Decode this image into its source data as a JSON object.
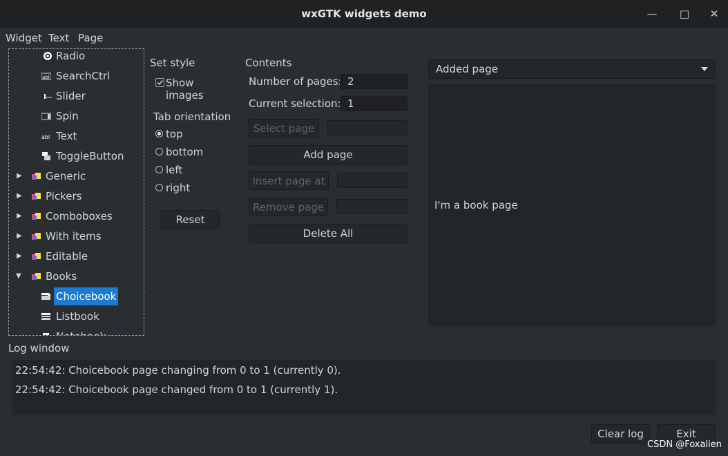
{
  "window": {
    "title": "wxGTK widgets demo",
    "minimize": "—",
    "maximize": "□",
    "close": "✕"
  },
  "menu": [
    "Widget",
    "Text",
    "Page"
  ],
  "tree": {
    "items": [
      {
        "label": "Radio",
        "icon": "radio-icon"
      },
      {
        "label": "SearchCtrl",
        "icon": "searchctrl-icon"
      },
      {
        "label": "Slider",
        "icon": "slider-icon"
      },
      {
        "label": "Spin",
        "icon": "spin-icon"
      },
      {
        "label": "Text",
        "icon": "text-icon"
      },
      {
        "label": "ToggleButton",
        "icon": "togglebutton-icon"
      },
      {
        "label": "Generic",
        "icon": "category-icon"
      },
      {
        "label": "Pickers",
        "icon": "category-icon"
      },
      {
        "label": "Comboboxes",
        "icon": "category-icon"
      },
      {
        "label": "With items",
        "icon": "category-icon"
      },
      {
        "label": "Editable",
        "icon": "category-icon"
      },
      {
        "label": "Books",
        "icon": "category-icon"
      },
      {
        "label": "Choicebook",
        "icon": "book-icon"
      },
      {
        "label": "Listbook",
        "icon": "book-icon"
      },
      {
        "label": "Notebook",
        "icon": "book-icon"
      }
    ]
  },
  "style": {
    "heading": "Set style",
    "show_images": "Show images",
    "tab_orientation": "Tab orientation",
    "options": [
      "top",
      "bottom",
      "left",
      "right"
    ],
    "reset": "Reset"
  },
  "contents": {
    "heading": "Contents",
    "num_pages_label": "Number of pages:",
    "num_pages_value": "2",
    "current_sel_label": "Current selection:",
    "current_sel_value": "1",
    "select_page": "Select page",
    "add_page": "Add page",
    "insert_page_at": "Insert page at",
    "remove_page": "Remove page",
    "delete_all": "Delete All"
  },
  "book": {
    "choice": "Added page",
    "page_text": "I'm a book page"
  },
  "log": {
    "title": "Log window",
    "lines": [
      "22:54:42: Choicebook page changing from 0 to 1 (currently 0).",
      "22:54:42: Choicebook page changed from 0 to 1 (currently 1)."
    ],
    "clear": "Clear log",
    "exit": "Exit"
  },
  "watermark": "CSDN @Foxalien",
  "colors": {
    "background": "#2b2e31",
    "titlebar": "#1f2123",
    "selection": "#1b7bd0"
  }
}
